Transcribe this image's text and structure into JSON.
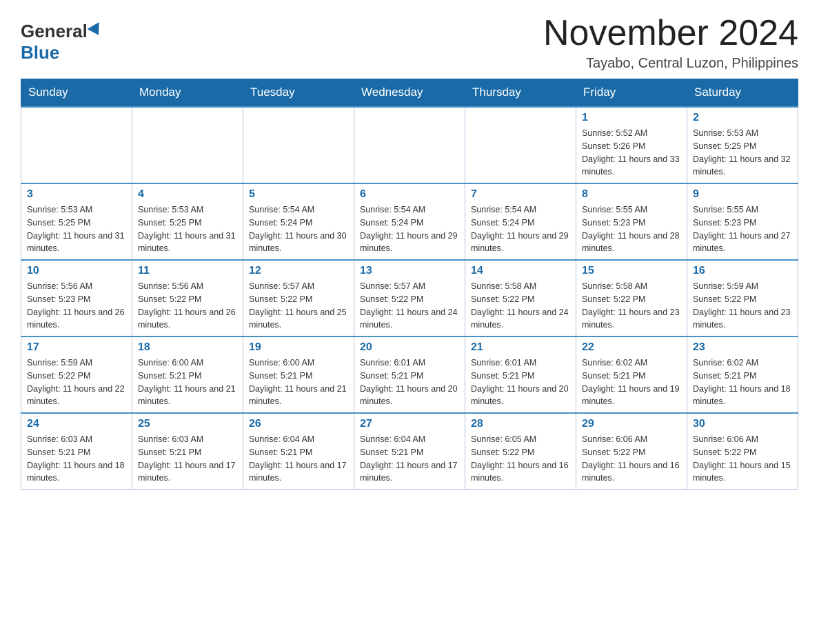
{
  "header": {
    "logo_general": "General",
    "logo_blue": "Blue",
    "title": "November 2024",
    "location": "Tayabo, Central Luzon, Philippines"
  },
  "weekdays": [
    "Sunday",
    "Monday",
    "Tuesday",
    "Wednesday",
    "Thursday",
    "Friday",
    "Saturday"
  ],
  "weeks": [
    [
      {
        "day": "",
        "info": ""
      },
      {
        "day": "",
        "info": ""
      },
      {
        "day": "",
        "info": ""
      },
      {
        "day": "",
        "info": ""
      },
      {
        "day": "",
        "info": ""
      },
      {
        "day": "1",
        "info": "Sunrise: 5:52 AM\nSunset: 5:26 PM\nDaylight: 11 hours and 33 minutes."
      },
      {
        "day": "2",
        "info": "Sunrise: 5:53 AM\nSunset: 5:25 PM\nDaylight: 11 hours and 32 minutes."
      }
    ],
    [
      {
        "day": "3",
        "info": "Sunrise: 5:53 AM\nSunset: 5:25 PM\nDaylight: 11 hours and 31 minutes."
      },
      {
        "day": "4",
        "info": "Sunrise: 5:53 AM\nSunset: 5:25 PM\nDaylight: 11 hours and 31 minutes."
      },
      {
        "day": "5",
        "info": "Sunrise: 5:54 AM\nSunset: 5:24 PM\nDaylight: 11 hours and 30 minutes."
      },
      {
        "day": "6",
        "info": "Sunrise: 5:54 AM\nSunset: 5:24 PM\nDaylight: 11 hours and 29 minutes."
      },
      {
        "day": "7",
        "info": "Sunrise: 5:54 AM\nSunset: 5:24 PM\nDaylight: 11 hours and 29 minutes."
      },
      {
        "day": "8",
        "info": "Sunrise: 5:55 AM\nSunset: 5:23 PM\nDaylight: 11 hours and 28 minutes."
      },
      {
        "day": "9",
        "info": "Sunrise: 5:55 AM\nSunset: 5:23 PM\nDaylight: 11 hours and 27 minutes."
      }
    ],
    [
      {
        "day": "10",
        "info": "Sunrise: 5:56 AM\nSunset: 5:23 PM\nDaylight: 11 hours and 26 minutes."
      },
      {
        "day": "11",
        "info": "Sunrise: 5:56 AM\nSunset: 5:22 PM\nDaylight: 11 hours and 26 minutes."
      },
      {
        "day": "12",
        "info": "Sunrise: 5:57 AM\nSunset: 5:22 PM\nDaylight: 11 hours and 25 minutes."
      },
      {
        "day": "13",
        "info": "Sunrise: 5:57 AM\nSunset: 5:22 PM\nDaylight: 11 hours and 24 minutes."
      },
      {
        "day": "14",
        "info": "Sunrise: 5:58 AM\nSunset: 5:22 PM\nDaylight: 11 hours and 24 minutes."
      },
      {
        "day": "15",
        "info": "Sunrise: 5:58 AM\nSunset: 5:22 PM\nDaylight: 11 hours and 23 minutes."
      },
      {
        "day": "16",
        "info": "Sunrise: 5:59 AM\nSunset: 5:22 PM\nDaylight: 11 hours and 23 minutes."
      }
    ],
    [
      {
        "day": "17",
        "info": "Sunrise: 5:59 AM\nSunset: 5:22 PM\nDaylight: 11 hours and 22 minutes."
      },
      {
        "day": "18",
        "info": "Sunrise: 6:00 AM\nSunset: 5:21 PM\nDaylight: 11 hours and 21 minutes."
      },
      {
        "day": "19",
        "info": "Sunrise: 6:00 AM\nSunset: 5:21 PM\nDaylight: 11 hours and 21 minutes."
      },
      {
        "day": "20",
        "info": "Sunrise: 6:01 AM\nSunset: 5:21 PM\nDaylight: 11 hours and 20 minutes."
      },
      {
        "day": "21",
        "info": "Sunrise: 6:01 AM\nSunset: 5:21 PM\nDaylight: 11 hours and 20 minutes."
      },
      {
        "day": "22",
        "info": "Sunrise: 6:02 AM\nSunset: 5:21 PM\nDaylight: 11 hours and 19 minutes."
      },
      {
        "day": "23",
        "info": "Sunrise: 6:02 AM\nSunset: 5:21 PM\nDaylight: 11 hours and 18 minutes."
      }
    ],
    [
      {
        "day": "24",
        "info": "Sunrise: 6:03 AM\nSunset: 5:21 PM\nDaylight: 11 hours and 18 minutes."
      },
      {
        "day": "25",
        "info": "Sunrise: 6:03 AM\nSunset: 5:21 PM\nDaylight: 11 hours and 17 minutes."
      },
      {
        "day": "26",
        "info": "Sunrise: 6:04 AM\nSunset: 5:21 PM\nDaylight: 11 hours and 17 minutes."
      },
      {
        "day": "27",
        "info": "Sunrise: 6:04 AM\nSunset: 5:21 PM\nDaylight: 11 hours and 17 minutes."
      },
      {
        "day": "28",
        "info": "Sunrise: 6:05 AM\nSunset: 5:22 PM\nDaylight: 11 hours and 16 minutes."
      },
      {
        "day": "29",
        "info": "Sunrise: 6:06 AM\nSunset: 5:22 PM\nDaylight: 11 hours and 16 minutes."
      },
      {
        "day": "30",
        "info": "Sunrise: 6:06 AM\nSunset: 5:22 PM\nDaylight: 11 hours and 15 minutes."
      }
    ]
  ]
}
